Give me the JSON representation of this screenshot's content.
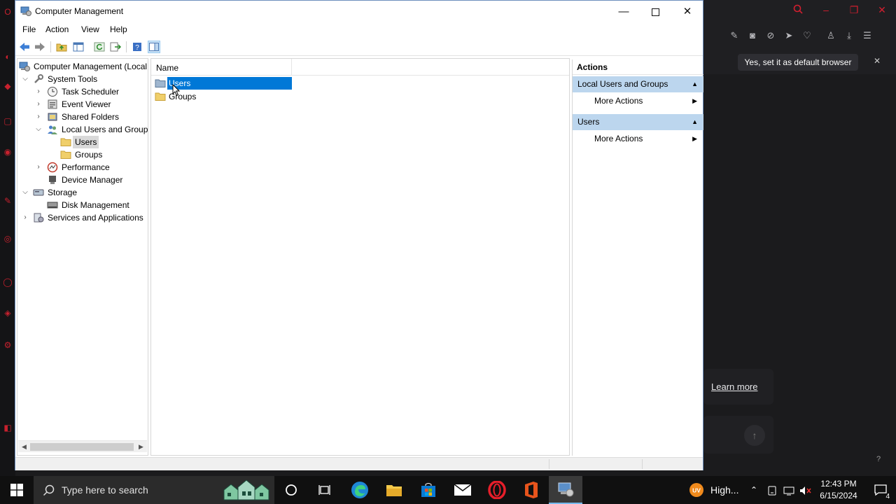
{
  "window": {
    "title": "Computer Management"
  },
  "menu": {
    "file": "File",
    "action": "Action",
    "view": "View",
    "help": "Help"
  },
  "tree": {
    "root": "Computer Management (Local",
    "items": [
      {
        "label": "System Tools"
      },
      {
        "label": "Task Scheduler"
      },
      {
        "label": "Event Viewer"
      },
      {
        "label": "Shared Folders"
      },
      {
        "label": "Local Users and Groups"
      },
      {
        "label": "Users"
      },
      {
        "label": "Groups"
      },
      {
        "label": "Performance"
      },
      {
        "label": "Device Manager"
      },
      {
        "label": "Storage"
      },
      {
        "label": "Disk Management"
      },
      {
        "label": "Services and Applications"
      }
    ]
  },
  "list": {
    "column_name": "Name",
    "rows": [
      {
        "label": "Users",
        "selected": true
      },
      {
        "label": "Groups",
        "selected": false
      }
    ]
  },
  "actions": {
    "title": "Actions",
    "section1": "Local Users and Groups",
    "section1_item": "More Actions",
    "section2": "Users",
    "section2_item": "More Actions"
  },
  "browser": {
    "default_button": "Yes, set it as default browser",
    "learn_more": "Learn more"
  },
  "taskbar": {
    "search_placeholder": "Type here to search",
    "weather_text": "High...",
    "uv_badge": "UV",
    "time": "12:43 PM",
    "date": "6/15/2024",
    "notification_count": "4"
  },
  "colors": {
    "selection": "#0078d7",
    "action_header": "#bcd6ee",
    "opera_red": "#d31f2f"
  }
}
